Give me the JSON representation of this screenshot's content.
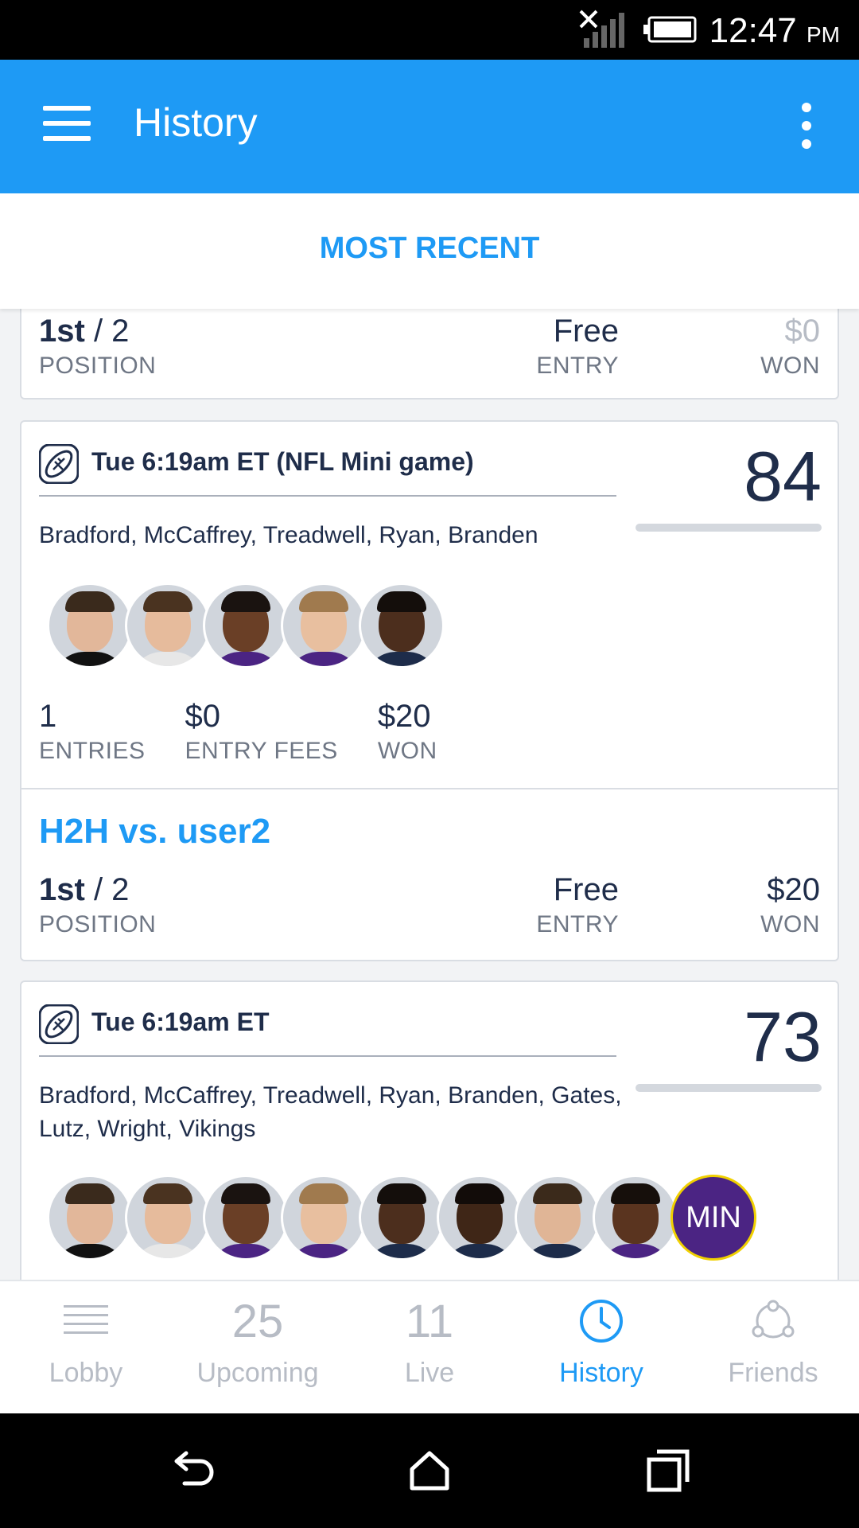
{
  "status_bar": {
    "time": "12:47",
    "ampm": "PM"
  },
  "app_bar": {
    "title": "History"
  },
  "sort": {
    "label": "MOST RECENT"
  },
  "partial_result": {
    "position_rank": "1st",
    "position_total": "/ 2",
    "position_caption": "POSITION",
    "entry_value": "Free",
    "entry_caption": "ENTRY",
    "won_value": "$0",
    "won_caption": "WON"
  },
  "contests": [
    {
      "name": "Tue 6:19am ET (NFL Mini game)",
      "score": "84",
      "players": "Bradford, McCaffrey, Treadwell, Ryan, Branden",
      "avatars": [
        "player",
        "player",
        "player",
        "player",
        "player"
      ],
      "stats": [
        {
          "value": "1",
          "caption": "ENTRIES"
        },
        {
          "value": "$0",
          "caption": "ENTRY FEES"
        },
        {
          "value": "$20",
          "caption": "WON"
        }
      ],
      "h2h": {
        "title": "H2H vs. user2",
        "position_rank": "1st",
        "position_total": "/ 2",
        "position_caption": "POSITION",
        "entry_value": "Free",
        "entry_caption": "ENTRY",
        "won_value": "$20",
        "won_caption": "WON"
      }
    },
    {
      "name": "Tue 6:19am ET",
      "score": "73",
      "players": "Bradford, McCaffrey, Treadwell, Ryan, Branden, Gates, Lutz, Wright, Vikings",
      "team_badge": "MIN"
    }
  ],
  "bottom_nav": [
    {
      "label": "Lobby",
      "icon": "list-icon"
    },
    {
      "label": "Upcoming",
      "count": "25"
    },
    {
      "label": "Live",
      "count": "11"
    },
    {
      "label": "History",
      "icon": "clock-icon",
      "active": true
    },
    {
      "label": "Friends",
      "icon": "friends-icon"
    }
  ],
  "colors": {
    "accent": "#1e9af5",
    "text": "#1f2d4a",
    "muted": "#b7bcc5"
  }
}
